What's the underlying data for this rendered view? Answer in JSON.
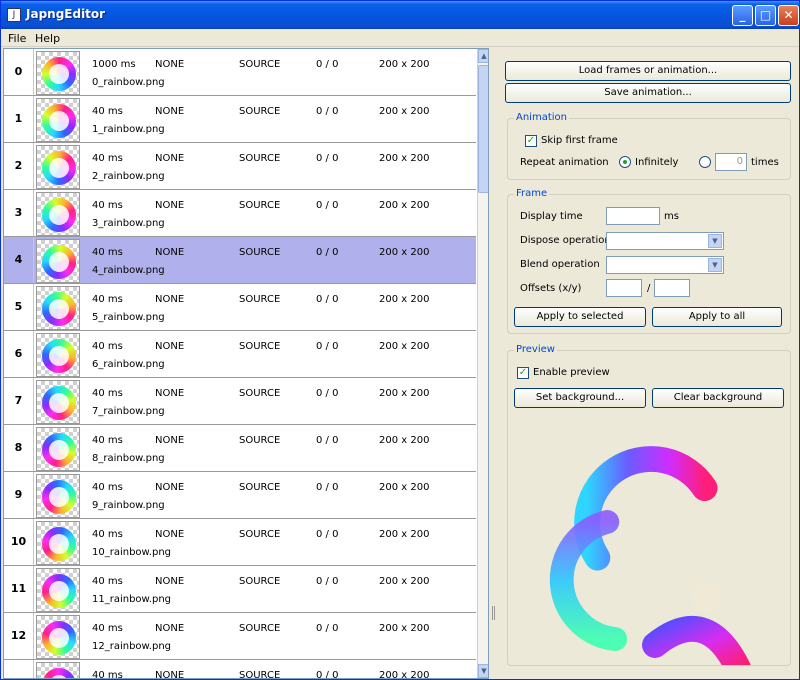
{
  "window": {
    "title": "JapngEditor",
    "min_glyph": "_",
    "max_glyph": "□",
    "close_glyph": "✕",
    "app_icon_glyph": "J"
  },
  "menu": {
    "file": "File",
    "help": "Help"
  },
  "frames": [
    {
      "index": "0",
      "time": "1000 ms",
      "dispose": "NONE",
      "blend": "SOURCE",
      "offsets": "0 / 0",
      "size": "200 x 200",
      "file": "0_rainbow.png"
    },
    {
      "index": "1",
      "time": "40 ms",
      "dispose": "NONE",
      "blend": "SOURCE",
      "offsets": "0 / 0",
      "size": "200 x 200",
      "file": "1_rainbow.png"
    },
    {
      "index": "2",
      "time": "40 ms",
      "dispose": "NONE",
      "blend": "SOURCE",
      "offsets": "0 / 0",
      "size": "200 x 200",
      "file": "2_rainbow.png"
    },
    {
      "index": "3",
      "time": "40 ms",
      "dispose": "NONE",
      "blend": "SOURCE",
      "offsets": "0 / 0",
      "size": "200 x 200",
      "file": "3_rainbow.png"
    },
    {
      "index": "4",
      "time": "40 ms",
      "dispose": "NONE",
      "blend": "SOURCE",
      "offsets": "0 / 0",
      "size": "200 x 200",
      "file": "4_rainbow.png"
    },
    {
      "index": "5",
      "time": "40 ms",
      "dispose": "NONE",
      "blend": "SOURCE",
      "offsets": "0 / 0",
      "size": "200 x 200",
      "file": "5_rainbow.png"
    },
    {
      "index": "6",
      "time": "40 ms",
      "dispose": "NONE",
      "blend": "SOURCE",
      "offsets": "0 / 0",
      "size": "200 x 200",
      "file": "6_rainbow.png"
    },
    {
      "index": "7",
      "time": "40 ms",
      "dispose": "NONE",
      "blend": "SOURCE",
      "offsets": "0 / 0",
      "size": "200 x 200",
      "file": "7_rainbow.png"
    },
    {
      "index": "8",
      "time": "40 ms",
      "dispose": "NONE",
      "blend": "SOURCE",
      "offsets": "0 / 0",
      "size": "200 x 200",
      "file": "8_rainbow.png"
    },
    {
      "index": "9",
      "time": "40 ms",
      "dispose": "NONE",
      "blend": "SOURCE",
      "offsets": "0 / 0",
      "size": "200 x 200",
      "file": "9_rainbow.png"
    },
    {
      "index": "10",
      "time": "40 ms",
      "dispose": "NONE",
      "blend": "SOURCE",
      "offsets": "0 / 0",
      "size": "200 x 200",
      "file": "10_rainbow.png"
    },
    {
      "index": "11",
      "time": "40 ms",
      "dispose": "NONE",
      "blend": "SOURCE",
      "offsets": "0 / 0",
      "size": "200 x 200",
      "file": "11_rainbow.png"
    },
    {
      "index": "12",
      "time": "40 ms",
      "dispose": "NONE",
      "blend": "SOURCE",
      "offsets": "0 / 0",
      "size": "200 x 200",
      "file": "12_rainbow.png"
    },
    {
      "index": "",
      "time": "40 ms",
      "dispose": "NONE",
      "blend": "SOURCE",
      "offsets": "0 / 0",
      "size": "200 x 200",
      "file": ""
    }
  ],
  "selected_frame": 4,
  "buttons": {
    "load": "Load frames or animation...",
    "save": "Save animation..."
  },
  "animation": {
    "legend": "Animation",
    "skip_first_frame": "Skip first frame",
    "skip_checked": true,
    "repeat_label": "Repeat animation",
    "infinitely": "Infinitely",
    "times_value": "0",
    "times": "times"
  },
  "frame_group": {
    "legend": "Frame",
    "display_time": "Display time",
    "ms": "ms",
    "dispose": "Dispose operation",
    "blend": "Blend operation",
    "offsets": "Offsets (x/y)",
    "slash": "/",
    "apply_selected": "Apply to selected",
    "apply_all": "Apply to all"
  },
  "preview": {
    "legend": "Preview",
    "enable": "Enable preview",
    "enable_checked": true,
    "set_bg": "Set background...",
    "clear_bg": "Clear background"
  },
  "colors": {
    "selection": "#b0b0ec",
    "legend": "#0046d5",
    "titlebar": "#0556e0"
  },
  "icons": {
    "check": "✓",
    "scroll_up": "▲",
    "scroll_down": "▼",
    "combo_drop": "▼"
  }
}
